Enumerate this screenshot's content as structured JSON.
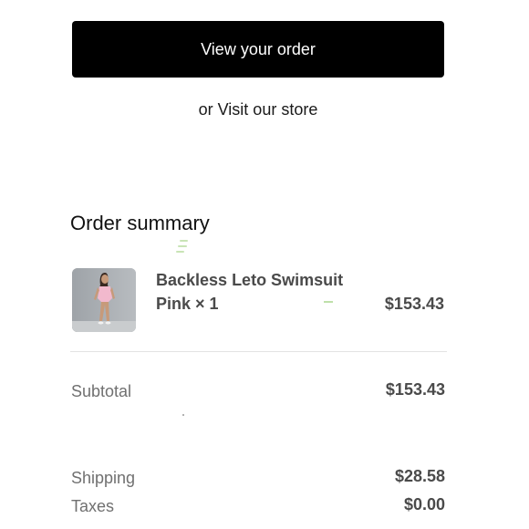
{
  "actions": {
    "view_order_label": "View your order",
    "visit_store_label": "or Visit our store"
  },
  "summary": {
    "title": "Order summary",
    "items": [
      {
        "name": "Backless Leto Swimsuit",
        "variant": "Pink × 1",
        "price": "$153.43",
        "thumbnail": "product-photo-icon"
      }
    ],
    "subtotal_label": "Subtotal",
    "subtotal_value": "$153.43",
    "shipping_label": "Shipping",
    "shipping_value": "$28.58",
    "taxes_label": "Taxes",
    "taxes_value": "$0.00"
  },
  "colors": {
    "button_bg": "#000000",
    "button_text": "#ffffff",
    "muted_text": "#707070",
    "value_text": "#4a4a4a",
    "divider": "#e3e3e3"
  }
}
